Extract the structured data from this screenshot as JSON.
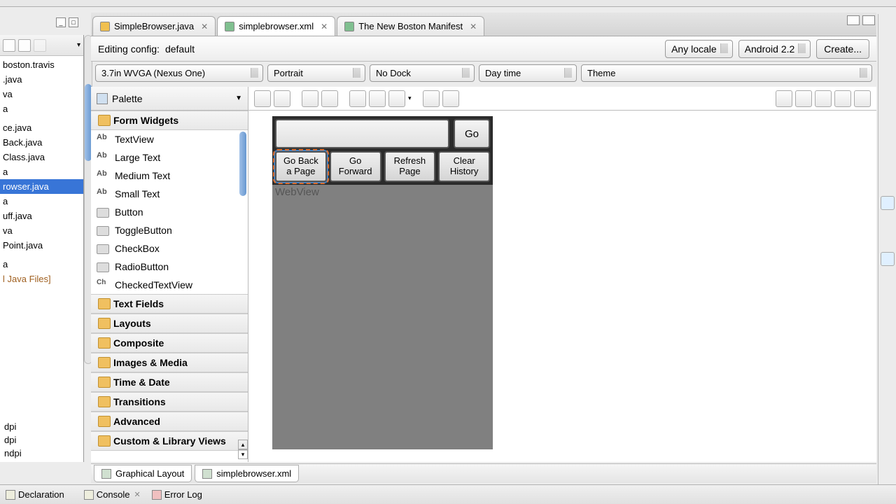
{
  "tabs": [
    {
      "label": "SimpleBrowser.java",
      "kind": "java"
    },
    {
      "label": "simplebrowser.xml",
      "kind": "xml",
      "active": true
    },
    {
      "label": "The New Boston Manifest",
      "kind": "xml"
    }
  ],
  "config_bar": {
    "label": "Editing config:",
    "value": "default",
    "locale": "Any locale",
    "target": "Android 2.2",
    "create": "Create..."
  },
  "device_row": {
    "device": "3.7in WVGA (Nexus One)",
    "orientation": "Portrait",
    "dock": "No Dock",
    "time": "Day time",
    "theme": "Theme"
  },
  "palette": {
    "title": "Palette",
    "groups": {
      "form_widgets": "Form Widgets",
      "text_fields": "Text Fields",
      "layouts": "Layouts",
      "composite": "Composite",
      "images_media": "Images & Media",
      "time_date": "Time & Date",
      "transitions": "Transitions",
      "advanced": "Advanced",
      "custom": "Custom & Library Views"
    },
    "widgets": {
      "textview": "TextView",
      "large_text": "Large Text",
      "medium_text": "Medium Text",
      "small_text": "Small Text",
      "button": "Button",
      "toggle": "ToggleButton",
      "checkbox": "CheckBox",
      "radio": "RadioButton",
      "checkedtext": "CheckedTextView"
    }
  },
  "preview": {
    "go": "Go",
    "back": "Go Back\na Page",
    "forward": "Go\nForward",
    "refresh": "Refresh\nPage",
    "clear": "Clear\nHistory",
    "webview": "WebView"
  },
  "bottom_tabs": {
    "graphical": "Graphical Layout",
    "xml": "simplebrowser.xml"
  },
  "views_bar": {
    "declaration": "Declaration",
    "console": "Console",
    "errorlog": "Error Log"
  },
  "file_list": [
    "boston.travis",
    ".java",
    "va",
    "a",
    "",
    "ce.java",
    "Back.java",
    "Class.java",
    "a",
    "rowser.java",
    "a",
    "uff.java",
    "va",
    "Point.java",
    "",
    "a",
    "l Java Files]"
  ],
  "dpi_list": [
    "dpi",
    "dpi",
    "ndpi"
  ]
}
